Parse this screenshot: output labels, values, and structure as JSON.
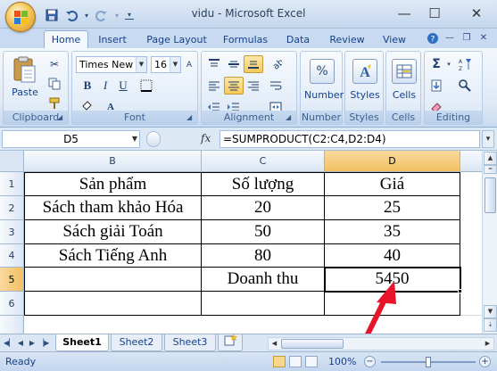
{
  "window": {
    "title": "vidu - Microsoft Excel",
    "minimize": "—",
    "maximize": "☐",
    "close": "✕"
  },
  "quick_access": {
    "save": "💾",
    "undo": "↶",
    "undo_drop": "▾",
    "redo": "↷",
    "redo_drop": "▾",
    "customize": "▾"
  },
  "tabs": [
    "Home",
    "Insert",
    "Page Layout",
    "Formulas",
    "Data",
    "Review",
    "View"
  ],
  "active_tab": "Home",
  "ribbon": {
    "clipboard": {
      "label": "Clipboard",
      "paste": "Paste"
    },
    "font": {
      "label": "Font",
      "font_name": "Times New Ro",
      "font_size": "16",
      "bold": "B",
      "italic": "I",
      "underline": "U"
    },
    "alignment": {
      "label": "Alignment"
    },
    "number": {
      "label": "Number",
      "symbol": "%"
    },
    "styles": {
      "label": "Styles"
    },
    "cells": {
      "label": "Cells"
    },
    "editing": {
      "label": "Editing",
      "sum": "Σ"
    }
  },
  "formula_bar": {
    "name_box": "D5",
    "fx": "fx",
    "formula": "=SUMPRODUCT(C2:C4,D2:D4)"
  },
  "grid": {
    "columns": [
      "B",
      "C",
      "D"
    ],
    "rows": [
      "1",
      "2",
      "3",
      "4",
      "5",
      "6"
    ],
    "cells": [
      [
        "Sản phẩm",
        "Số lượng",
        "Giá"
      ],
      [
        "Sách tham khảo Hóa",
        "20",
        "25"
      ],
      [
        "Sách giải Toán",
        "50",
        "35"
      ],
      [
        "Sách Tiếng Anh",
        "80",
        "40"
      ],
      [
        "",
        "Doanh thu",
        "5450"
      ],
      [
        "",
        "",
        ""
      ]
    ],
    "selected_cell": "D5",
    "arrow_color": "#e8142a"
  },
  "sheets": [
    "Sheet1",
    "Sheet2",
    "Sheet3"
  ],
  "active_sheet": "Sheet1",
  "status": {
    "text": "Ready",
    "zoom": "100%"
  }
}
